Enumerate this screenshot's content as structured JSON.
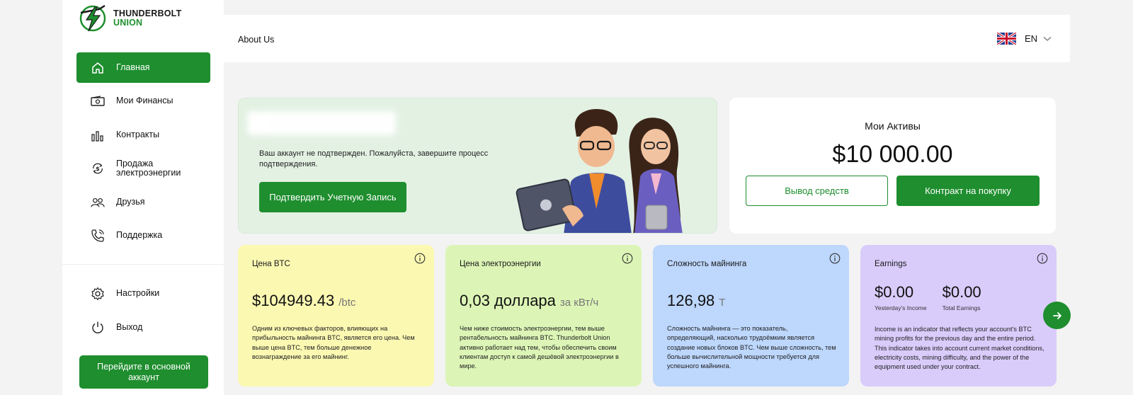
{
  "brand": {
    "line1": "THUNDERBOLT",
    "line2": "UNION"
  },
  "sidebar": {
    "items": [
      {
        "label": "Главная",
        "icon": "home-icon"
      },
      {
        "label": "Мои Финансы",
        "icon": "wallet-icon"
      },
      {
        "label": "Контракты",
        "icon": "bar-chart-icon"
      },
      {
        "label": "Продажа электроэнергии",
        "icon": "dollar-exchange-icon"
      },
      {
        "label": "Друзья",
        "icon": "friends-icon"
      },
      {
        "label": "Поддержка",
        "icon": "phone-icon"
      }
    ],
    "bottom_items": [
      {
        "label": "Настройки",
        "icon": "gear-icon"
      },
      {
        "label": "Выход",
        "icon": "power-icon"
      }
    ],
    "main_account_button": "Перейдите в основной аккаунт"
  },
  "header": {
    "about": "About Us",
    "language": "EN",
    "flag_icon": "uk-flag-icon"
  },
  "banner": {
    "message": "Ваш аккаунт не подтвержден. Пожалуйста, завершите процесс подтверждения.",
    "verify_button": "Подтвердить Учетную Запись"
  },
  "assets": {
    "title": "Мои Активы",
    "amount": "$10 000.00",
    "withdraw_button": "Вывод средств",
    "buy_button": "Контракт на покупку"
  },
  "cards": {
    "btc": {
      "title": "Цена BTC",
      "value": "$104949.43",
      "unit": "/btc",
      "description": "Одним из ключевых факторов, влияющих на прибыльность майнинга BTC, является его цена. Чем выше цена BTC, тем больше денежное вознаграждение за его майнинг."
    },
    "electricity": {
      "title": "Цена электроэнергии",
      "value": "0,03 доллара",
      "unit": "за кВт/ч",
      "description": "Чем ниже стоимость электроэнергии, тем выше рентабельность майнинга BTC. Thunderbolt Union активно работает над тем, чтобы обеспечить своим клиентам доступ к самой дешёвой электроэнергии в мире."
    },
    "difficulty": {
      "title": "Сложность майнинга",
      "value": "126,98",
      "unit": "T",
      "description": "Сложность майнинга — это показатель, определяющий, насколько трудоёмким является создание новых блоков BTC. Чем выше сложность, тем больше вычислительной мощности требуется для успешного майнинга."
    },
    "earnings": {
      "title": "Earnings",
      "yesterday_value": "$0.00",
      "yesterday_label": "Yesterday's Income",
      "total_value": "$0.00",
      "total_label": "Total Earnings",
      "description": "Income is an indicator that reflects your account's BTC mining profits for the previous day and the entire period. This indicator takes into account current market conditions, electricity costs, mining difficulty, and the power of the equipment used under your contract."
    }
  },
  "colors": {
    "accent": "#1e8e2e",
    "card_btc": "#fbf8b2",
    "card_electricity": "#dcf5b6",
    "card_difficulty": "#bdd7fd",
    "card_earnings": "#d9ccfb"
  }
}
